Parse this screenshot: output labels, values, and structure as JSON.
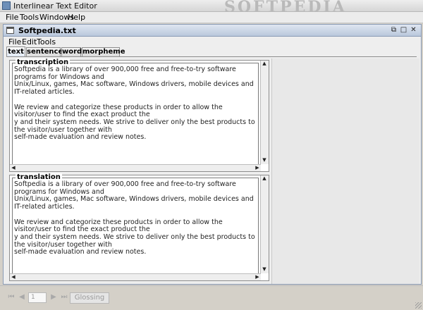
{
  "window": {
    "title": "Interlinear Text Editor",
    "watermark": "SOFTPEDIA"
  },
  "menubar": [
    "File",
    "Tools",
    "Windows",
    "Help"
  ],
  "document": {
    "title": "Softpedia.txt",
    "menu": [
      "File",
      "Edit",
      "Tools"
    ],
    "tabs": [
      "text",
      "sentence",
      "word",
      "morpheme"
    ],
    "active_tab": "text",
    "transcription": {
      "label": "transcription",
      "text": "Softpedia is a library of over 900,000 free and free-to-try software programs for Windows and\nUnix/Linux, games, Mac software, Windows drivers, mobile devices and IT-related articles.\n\nWe review and categorize these products in order to allow the visitor/user to find the exact product the\ny and their system needs. We strive to deliver only the best products to the visitor/user together with\nself-made evaluation and review notes."
    },
    "translation": {
      "label": "translation",
      "text": "Softpedia is a library of over 900,000 free and free-to-try software programs for Windows and\nUnix/Linux, games, Mac software, Windows drivers, mobile devices and IT-related articles.\n\nWe review and categorize these products in order to allow the visitor/user to find the exact product the\ny and their system needs. We strive to deliver only the best products to the visitor/user together with\nself-made evaluation and review notes."
    }
  },
  "statusbar": {
    "page_value": "1",
    "glossing_label": "Glossing"
  },
  "icons": {
    "first": "first-page-icon",
    "previous": "previous-page-icon",
    "next": "next-page-icon",
    "last": "last-page-icon"
  }
}
